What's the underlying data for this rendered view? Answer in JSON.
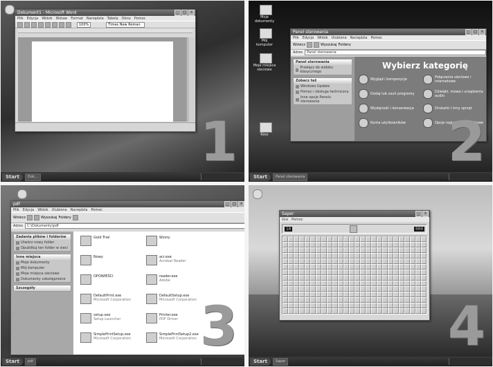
{
  "taskbar": {
    "start_label": "Start"
  },
  "q1": {
    "number": "1",
    "window_title": "Dokument1 - Microsoft Word",
    "menu": [
      "Plik",
      "Edycja",
      "Widok",
      "Wstaw",
      "Format",
      "Narzędzia",
      "Tabela",
      "Okno",
      "Pomoc"
    ],
    "zoom": "100%",
    "style_box": "Times New Roman",
    "taskbar_button": "Dok..."
  },
  "q2": {
    "number": "2",
    "desktop_icons": [
      "Moje dokumenty",
      "Mój komputer",
      "Moje miejsca sieciowe",
      "Kosz"
    ],
    "window_title": "Panel sterowania",
    "menu": [
      "Plik",
      "Edycja",
      "Widok",
      "Ulubione",
      "Narzędzia",
      "Pomoc"
    ],
    "nav": {
      "back": "Wstecz",
      "search": "Wyszukaj",
      "folders": "Foldery"
    },
    "address_label": "Adres",
    "address_value": "Panel sterowania",
    "left_panel_title": "Panel sterowania",
    "left_panel_item": "Przełącz do widoku klasycznego",
    "see_also_title": "Zobacz też",
    "see_also_items": [
      "Windows Update",
      "Pomoc i obsługa techniczna",
      "Inne opcje Panelu sterowania"
    ],
    "heading": "Wybierz kategorię",
    "categories": [
      "Wygląd i kompozycje",
      "Połączenia sieciowe i internetowe",
      "Dodaj lub usuń programy",
      "Dźwięki, mowa i urządzenia audio",
      "Wydajność i konserwacja",
      "Drukarki i inny sprzęt",
      "Konta użytkowników",
      "Opcje regionalne i językowe"
    ],
    "taskbar_button": "Panel sterowania"
  },
  "q3": {
    "number": "3",
    "window_title": "pdf",
    "menu": [
      "Plik",
      "Edycja",
      "Widok",
      "Ulubione",
      "Narzędzia",
      "Pomoc"
    ],
    "nav": {
      "back": "Wstecz",
      "search": "Wyszukaj",
      "folders": "Foldery"
    },
    "address_label": "Adres",
    "address_value": "C:\\Dokumenty\\pdf",
    "tasks_title": "Zadania plików i folderów",
    "tasks_items": [
      "Utwórz nowy folder",
      "Opublikuj ten folder w sieci"
    ],
    "places_title": "Inne miejsca",
    "places_items": [
      "Moje dokumenty",
      "Mój komputer",
      "Moje miejsca sieciowe",
      "Dokumenty udostępnione"
    ],
    "details_title": "Szczegóły",
    "files": [
      {
        "name": "Gold Trial",
        "sub": ""
      },
      {
        "name": "Wzory",
        "sub": ""
      },
      {
        "name": "Nowy",
        "sub": ""
      },
      {
        "name": "acr.exe",
        "sub": "Acrobat Reader"
      },
      {
        "name": "OPOWIEŚCI",
        "sub": ""
      },
      {
        "name": "reader.exe",
        "sub": "Adobe"
      },
      {
        "name": "DefaultPrint.exe",
        "sub": "Microsoft Corporation"
      },
      {
        "name": "DefaultSetup.exe",
        "sub": "Microsoft Corporation"
      },
      {
        "name": "setup.exe",
        "sub": "Setup Launcher"
      },
      {
        "name": "Printer.exe",
        "sub": "PDF Driver"
      },
      {
        "name": "SimplePrintSetup.exe",
        "sub": "Microsoft Corporation"
      },
      {
        "name": "SimplePrintSetup2.exe",
        "sub": "Microsoft Corporation"
      }
    ],
    "taskbar_button": "pdf"
  },
  "q4": {
    "number": "4",
    "window_title": "Saper",
    "menu": [
      "Gra",
      "Pomoc"
    ],
    "mines_counter": "10",
    "timer": "000",
    "grid_rows": 16,
    "grid_cols": 30,
    "taskbar_button": "Saper"
  }
}
